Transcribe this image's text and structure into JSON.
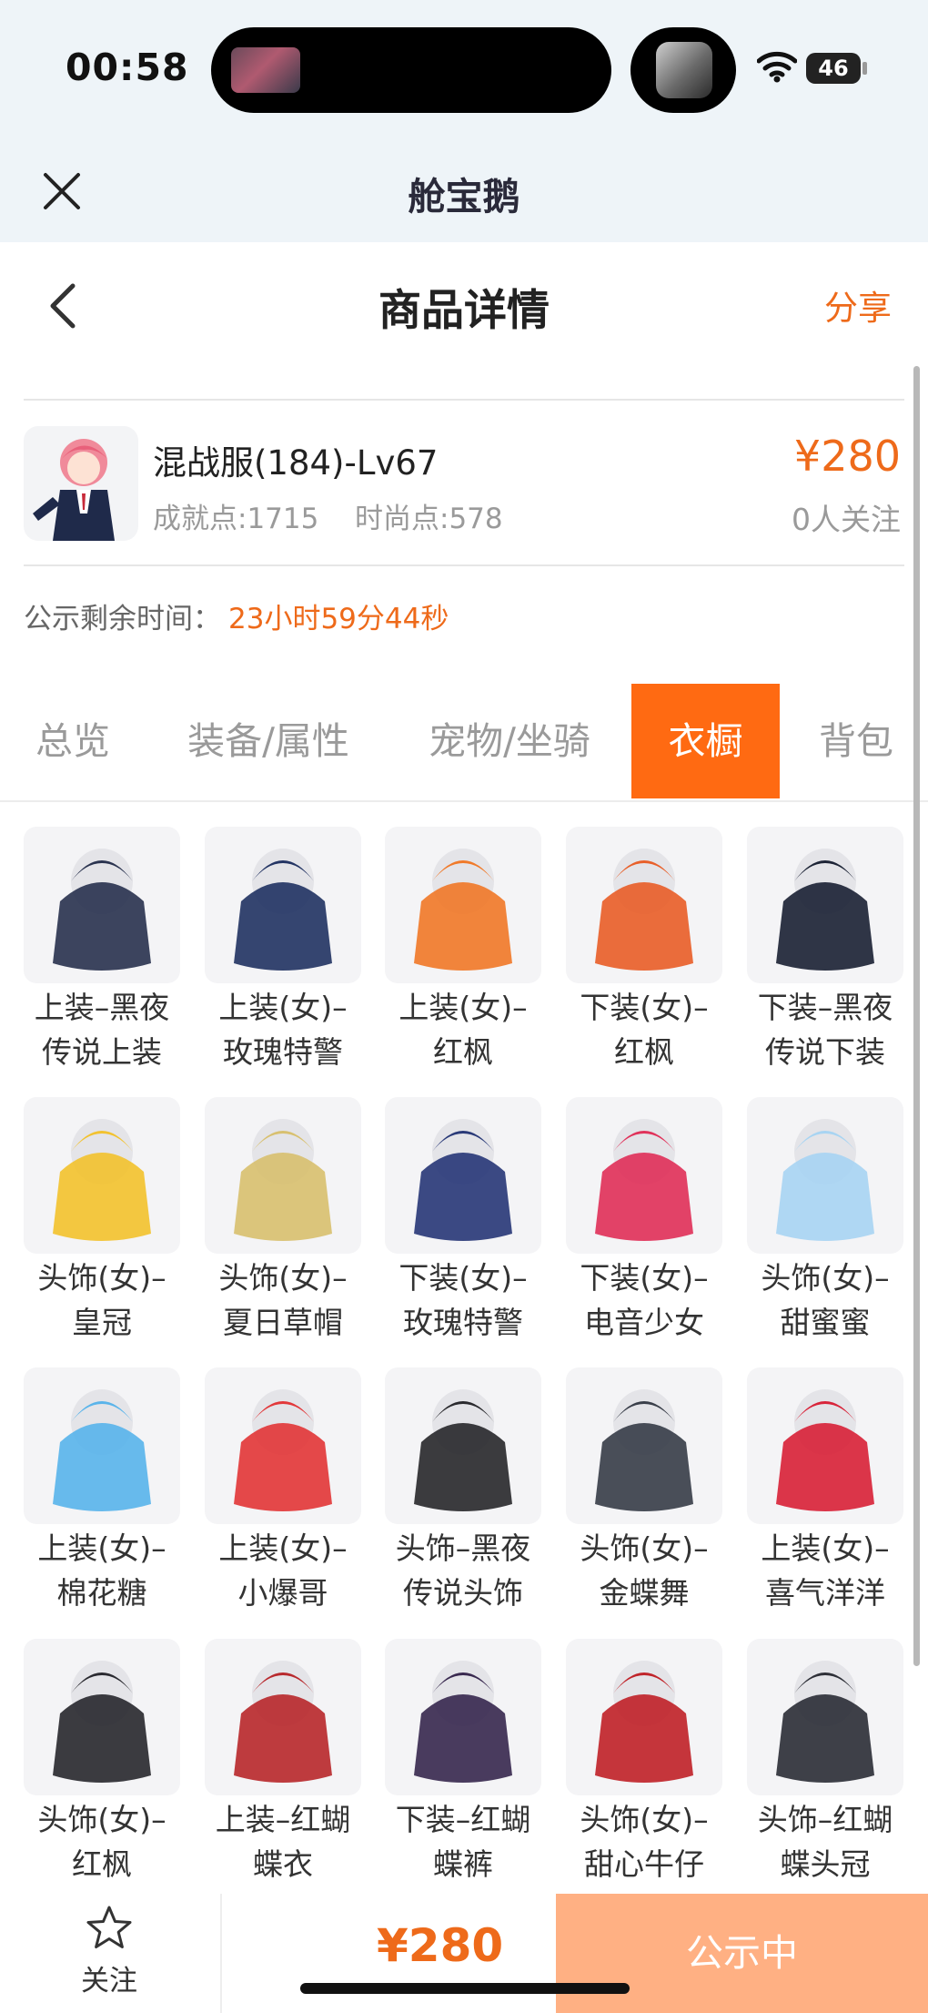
{
  "status_bar": {
    "time": "00:58",
    "battery": "46"
  },
  "app_header": {
    "title": "舱宝鹅"
  },
  "page_header": {
    "title": "商品详情",
    "share_label": "分享"
  },
  "product": {
    "name": "混战服(184)-Lv67",
    "achievement": "成就点:1715",
    "fashion": "时尚点:578",
    "price": "¥280",
    "watchers": "0人关注"
  },
  "notice": {
    "label": "公示剩余时间：",
    "value": "23小时59分44秒"
  },
  "tabs": [
    {
      "label": "总览"
    },
    {
      "label": "装备/属性"
    },
    {
      "label": "宠物/坐骑"
    },
    {
      "label": "衣橱"
    },
    {
      "label": "背包"
    }
  ],
  "active_tab": "衣橱",
  "wardrobe_items": [
    {
      "line1": "上装–黑夜",
      "line2": "传说上装",
      "icon": "dark-coat-icon",
      "color": "#2b3450"
    },
    {
      "line1": "上装(女)–",
      "line2": "玫瑰特警",
      "icon": "navy-jacket-icon",
      "color": "#243564"
    },
    {
      "line1": "上装(女)–",
      "line2": "红枫",
      "icon": "maple-top-icon",
      "color": "#f07a2a"
    },
    {
      "line1": "下装(女)–",
      "line2": "红枫",
      "icon": "maple-skirt-icon",
      "color": "#e8602a"
    },
    {
      "line1": "下装–黑夜",
      "line2": "传说下装",
      "icon": "dark-pants-icon",
      "color": "#1d2436"
    },
    {
      "line1": "头饰(女)–",
      "line2": "皇冠",
      "icon": "crown-icon",
      "color": "#f2c230"
    },
    {
      "line1": "头饰(女)–",
      "line2": "夏日草帽",
      "icon": "straw-hat-icon",
      "color": "#d8c070"
    },
    {
      "line1": "下装(女)–",
      "line2": "玫瑰特警",
      "icon": "navy-boots-icon",
      "color": "#2a3a78"
    },
    {
      "line1": "下装(女)–",
      "line2": "电音少女",
      "icon": "sneakers-icon",
      "color": "#e0325a"
    },
    {
      "line1": "头饰(女)–",
      "line2": "甜蜜蜜",
      "icon": "cat-ears-icon",
      "color": "#a8d4f2"
    },
    {
      "line1": "上装(女)–",
      "line2": "棉花糖",
      "icon": "cloud-dress-icon",
      "color": "#5ab4ea"
    },
    {
      "line1": "上装(女)–",
      "line2": "小爆哥",
      "icon": "red-hoodie-icon",
      "color": "#e2383a"
    },
    {
      "line1": "头饰–黑夜",
      "line2": "传说头饰",
      "icon": "black-hair-icon",
      "color": "#2a2a2e"
    },
    {
      "line1": "头饰(女)–",
      "line2": "金蝶舞",
      "icon": "butterfly-hair-icon",
      "color": "#3a3f4a"
    },
    {
      "line1": "上装(女)–",
      "line2": "喜气洋洋",
      "icon": "red-qipao-icon",
      "color": "#d8243a"
    },
    {
      "line1": "头饰(女)–",
      "line2": "红枫",
      "icon": "maple-hairpin-icon",
      "color": "#2a2a30"
    },
    {
      "line1": "上装–红蝴",
      "line2": "蝶衣",
      "icon": "red-butterfly-coat-icon",
      "color": "#b82a2e"
    },
    {
      "line1": "下装–红蝴",
      "line2": "蝶裤",
      "icon": "red-butterfly-pants-icon",
      "color": "#3a2a50"
    },
    {
      "line1": "头饰(女)–",
      "line2": "甜心牛仔",
      "icon": "cowgirl-hat-icon",
      "color": "#c0242a"
    },
    {
      "line1": "头饰–红蝴",
      "line2": "蝶头冠",
      "icon": "butterfly-crown-icon",
      "color": "#2e3038"
    }
  ],
  "bottom_bar": {
    "follow_label": "关注",
    "price": "¥280",
    "cta_label": "公示中"
  }
}
